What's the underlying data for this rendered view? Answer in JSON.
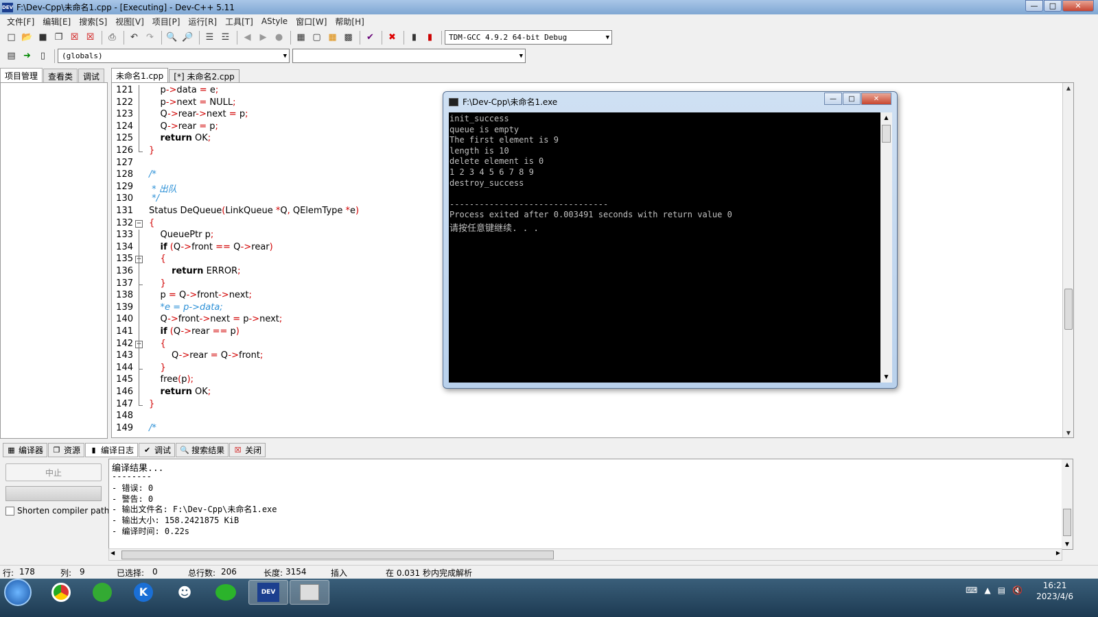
{
  "window": {
    "title": "F:\\Dev-Cpp\\未命名1.cpp - [Executing] - Dev-C++ 5.11",
    "app_badge": "DEV",
    "controls": [
      "minimize",
      "maximize",
      "close"
    ]
  },
  "menu": [
    "文件[F]",
    "编辑[E]",
    "搜索[S]",
    "视图[V]",
    "项目[P]",
    "运行[R]",
    "工具[T]",
    "AStyle",
    "窗口[W]",
    "帮助[H]"
  ],
  "toolbar": {
    "compiler_select": "TDM-GCC 4.9.2 64-bit Debug",
    "scope_select": "(globals)",
    "symbol_select": ""
  },
  "left_panel": {
    "tabs": [
      "项目管理",
      "查看类",
      "调试"
    ]
  },
  "editor": {
    "tabs": [
      "未命名1.cpp",
      "[*] 未命名2.cpp"
    ],
    "lines": [
      {
        "n": "121",
        "text": "    p->data = e;"
      },
      {
        "n": "122",
        "text": "    p->next = NULL;"
      },
      {
        "n": "123",
        "text": "    Q->rear->next = p;"
      },
      {
        "n": "124",
        "text": "    Q->rear = p;"
      },
      {
        "n": "125",
        "text": "    return OK;"
      },
      {
        "n": "126",
        "text": "}"
      },
      {
        "n": "127",
        "text": ""
      },
      {
        "n": "128",
        "text": "/*"
      },
      {
        "n": "129",
        "text": " * 出队"
      },
      {
        "n": "130",
        "text": " */"
      },
      {
        "n": "131",
        "text": "Status DeQueue(LinkQueue *Q, QElemType *e)"
      },
      {
        "n": "132",
        "text": "{"
      },
      {
        "n": "133",
        "text": "    QueuePtr p;"
      },
      {
        "n": "134",
        "text": "    if (Q->front == Q->rear)"
      },
      {
        "n": "135",
        "text": "    {"
      },
      {
        "n": "136",
        "text": "        return ERROR;"
      },
      {
        "n": "137",
        "text": "    }"
      },
      {
        "n": "138",
        "text": "    p = Q->front->next;"
      },
      {
        "n": "139",
        "text": "    *e = p->data;"
      },
      {
        "n": "140",
        "text": "    Q->front->next = p->next;"
      },
      {
        "n": "141",
        "text": "    if (Q->rear == p)"
      },
      {
        "n": "142",
        "text": "    {"
      },
      {
        "n": "143",
        "text": "        Q->rear = Q->front;"
      },
      {
        "n": "144",
        "text": "    }"
      },
      {
        "n": "145",
        "text": "    free(p);"
      },
      {
        "n": "146",
        "text": "    return OK;"
      },
      {
        "n": "147",
        "text": "}"
      },
      {
        "n": "148",
        "text": ""
      },
      {
        "n": "149",
        "text": "/*"
      }
    ]
  },
  "console": {
    "title": "F:\\Dev-Cpp\\未命名1.exe",
    "output": [
      "init_success",
      "queue is empty",
      "The first element is 9",
      "length is 10",
      "delete element is 0",
      "1 2 3 4 5 6 7 8 9",
      "destroy_success",
      "",
      "--------------------------------",
      "Process exited after 0.003491 seconds with return value 0",
      "请按任意键继续. . ."
    ]
  },
  "bottom_tabs": [
    "编译器",
    "资源",
    "编译日志",
    "调试",
    "搜索结果",
    "关闭"
  ],
  "bottom_left": {
    "abort_label": "中止",
    "shorten_label": "Shorten compiler paths"
  },
  "compile_log": [
    "编译结果...",
    "--------",
    "- 错误: 0",
    "- 警告: 0",
    "- 输出文件名: F:\\Dev-Cpp\\未命名1.exe",
    "- 输出大小: 158.2421875 KiB",
    "- 编译时间: 0.22s"
  ],
  "status": {
    "line_label": "行:",
    "line_value": "178",
    "col_label": "列:",
    "col_value": "9",
    "sel_label": "已选择:",
    "sel_value": "0",
    "total_label": "总行数:",
    "total_value": "206",
    "len_label": "长度:",
    "len_value": "3154",
    "mode": "插入",
    "parse_msg": "在 0.031 秒内完成解析"
  },
  "taskbar": {
    "time": "16:21",
    "date": "2023/4/6",
    "active_app": "DEV C++"
  }
}
